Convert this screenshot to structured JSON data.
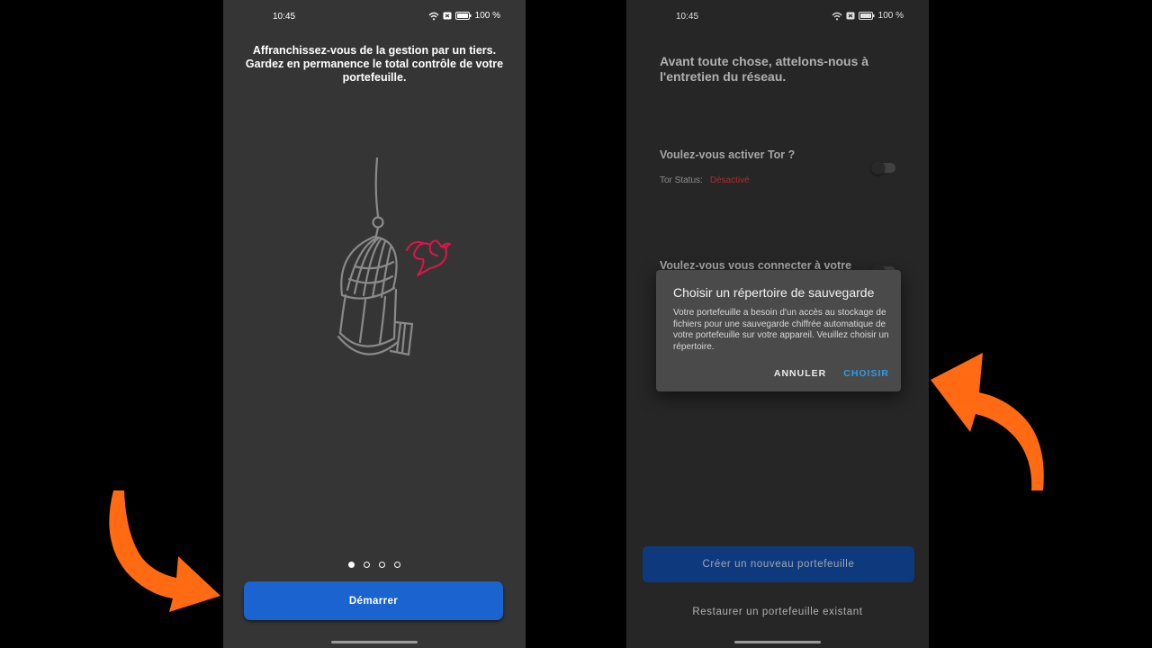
{
  "left_phone": {
    "status_bar": {
      "time": "10:45",
      "battery": "100 %",
      "icons": [
        "wifi-icon",
        "notification-icon",
        "battery-icon"
      ]
    },
    "intro_text": "Affranchissez-vous de la gestion par un tiers. Gardez en permanence le total contrôle de votre portefeuille.",
    "illustration": [
      "birdcage-icon",
      "bird-icon"
    ],
    "pager": {
      "pages": 4,
      "active": 1
    },
    "start_button": "Démarrer"
  },
  "right_phone": {
    "status_bar": {
      "time": "10:45",
      "battery": "100 %",
      "icons": [
        "wifi-icon",
        "notification-icon",
        "battery-icon"
      ]
    },
    "heading": "Avant toute chose, attelons-nous à l'entretien du réseau.",
    "tor_question": "Voulez-vous activer Tor ?",
    "tor_status_label": "Tor Status:",
    "tor_status_value": "Désactivé",
    "connect_question": "Voulez-vous vous connecter à votre",
    "dialog": {
      "title": "Choisir un répertoire de sauvegarde",
      "body": "Votre portefeuille a besoin d'un accès au stockage de fichiers pour une sauvegarde chiffrée automatique de votre portefeuille sur votre appareil. Veuillez choisir un répertoire.",
      "cancel": "ANNULER",
      "choose": "CHOISIR"
    },
    "create_button": "Créer un nouveau portefeuille",
    "restore_link": "Restaurer un portefeuille existant"
  },
  "colors": {
    "primary_button": "#1b63cf",
    "create_button": "#10428f",
    "dialog_action": "#2f9ce6",
    "bird": "#e0144a",
    "arrow": "#ff6a13",
    "tor_status_value": "#c23333"
  }
}
